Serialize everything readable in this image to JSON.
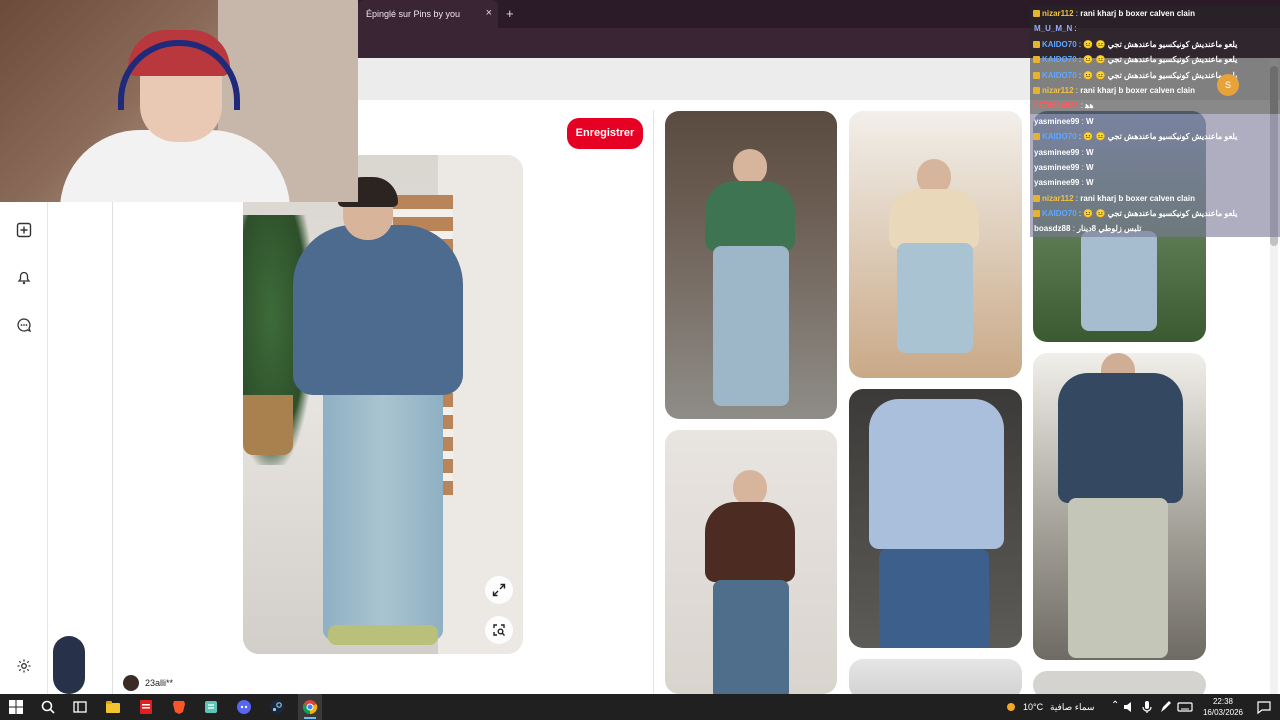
{
  "browser": {
    "tab_title": "Épinglé sur Pins by you",
    "tab_close": "×",
    "new_tab": "+"
  },
  "pin": {
    "save_label": "Enregistrer",
    "user_name": "23alli**"
  },
  "sidebar": {
    "icons": [
      "create-icon",
      "notifications-icon",
      "messages-icon",
      "settings-icon"
    ]
  },
  "chat": {
    "messages": [
      {
        "user": "nizar112",
        "user_color": "#f5c242",
        "badge": true,
        "text": "rani kharj b boxer calven clain",
        "highlight": false
      },
      {
        "user": "M_U_M_N",
        "user_color": "#9aa9ff",
        "badge": false,
        "text": "",
        "highlight": false
      },
      {
        "user": "KAIDO70",
        "user_color": "#5fa7ff",
        "badge": true,
        "text": "😐 😐 يلعو ماعنديش كونيكسيو ماعندهش تجي",
        "highlight": false
      },
      {
        "user": "KAIDO70",
        "user_color": "#5fa7ff",
        "badge": true,
        "text": "😐 😐 يلعو ماعنديش كونيكسيو ماعندهش تجي",
        "highlight": false
      },
      {
        "user": "KAIDO70",
        "user_color": "#5fa7ff",
        "badge": true,
        "text": "😐 😐 يلعو ماعنديش كونيكسيو ماعندهش تجي",
        "highlight": false
      },
      {
        "user": "nizar112",
        "user_color": "#f5c242",
        "badge": true,
        "text": "rani kharj b boxer calven clain",
        "highlight": false
      },
      {
        "user": "0776984833",
        "user_color": "#ff5a5a",
        "badge": false,
        "text": "ﻫﻫ",
        "highlight": false
      },
      {
        "user": "yasminee99",
        "user_color": "#ffffff",
        "badge": false,
        "text": "W",
        "highlight": true
      },
      {
        "user": "KAIDO70",
        "user_color": "#5fa7ff",
        "badge": true,
        "text": "😐 😐 يلعو ماعنديش كونيكسيو ماعندهش تجي",
        "highlight": true
      },
      {
        "user": "yasminee99",
        "user_color": "#ffffff",
        "badge": false,
        "text": "W",
        "highlight": true
      },
      {
        "user": "yasminee99",
        "user_color": "#ffffff",
        "badge": false,
        "text": "W",
        "highlight": true
      },
      {
        "user": "yasminee99",
        "user_color": "#ffffff",
        "badge": false,
        "text": "W",
        "highlight": true
      },
      {
        "user": "nizar112",
        "user_color": "#f5c242",
        "badge": true,
        "text": "rani kharj b boxer calven clain",
        "highlight": true
      },
      {
        "user": "KAIDO70",
        "user_color": "#5fa7ff",
        "badge": true,
        "text": "😐 😐 يلعو ماعنديش كونيكسيو ماعندهش تجي",
        "highlight": true
      },
      {
        "user": "boasdz88",
        "user_color": "#ffffff",
        "badge": false,
        "text": "تلبس زلوطي 8دينار",
        "highlight": true
      }
    ],
    "overlay_avatar_letter": "S"
  },
  "taskbar": {
    "weather_temp": "10°C",
    "weather_desc": "سماء صافية",
    "time": "22:38",
    "date": "16/03/2026",
    "apps": [
      "windows-start-icon",
      "search-icon",
      "task-view-icon",
      "files-icon",
      "pdf-icon",
      "brave-icon",
      "notepad-icon",
      "discord-icon",
      "steam-icon",
      "chrome-icon"
    ]
  }
}
